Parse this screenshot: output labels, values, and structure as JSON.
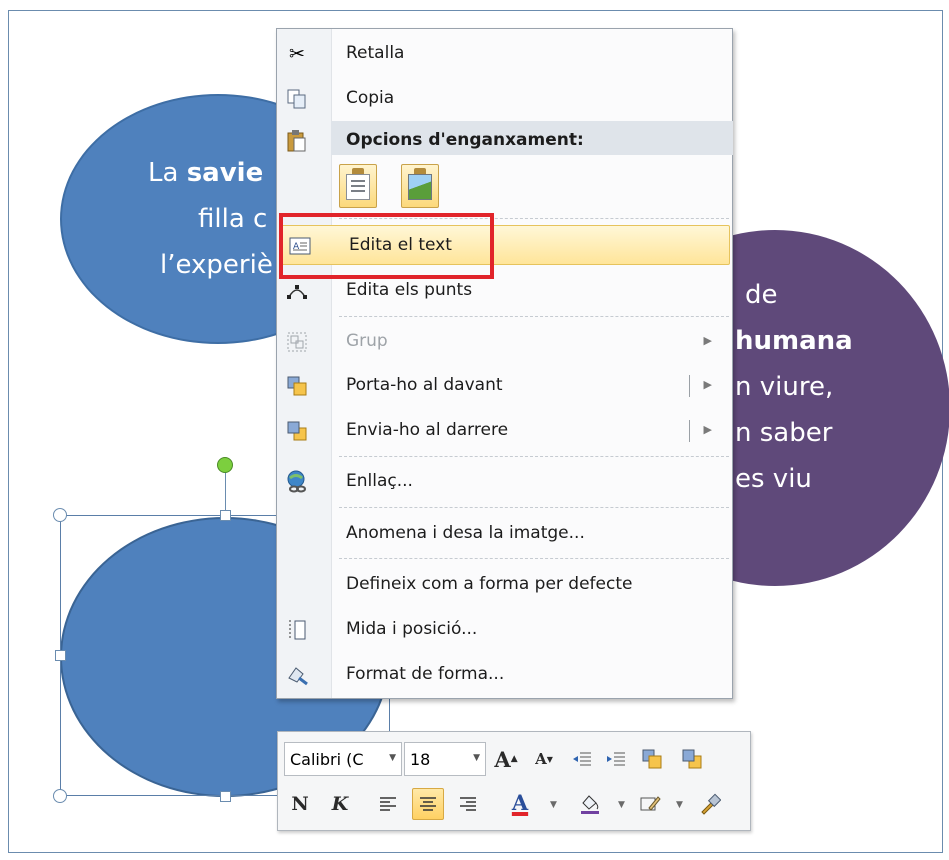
{
  "slide": {
    "top_left_text": {
      "line1_pre": "La ",
      "line1_bold": "savie",
      "line2": "filla c",
      "line3": "l’experiè"
    },
    "right_text": {
      "line1": "de",
      "line2_bold": "humana",
      "line3": "n viure,",
      "line4": "n saber",
      "line5": "es viu"
    }
  },
  "context_menu": {
    "items": [
      {
        "label": "Retalla",
        "icon": "scissors-icon"
      },
      {
        "label": "Copia",
        "icon": "copy-icon"
      },
      {
        "label": "Opcions d'enganxament:",
        "icon": "paste-icon"
      },
      {
        "label": "Edita el text",
        "icon": "edit-text-icon"
      },
      {
        "label": "Edita els punts",
        "icon": "edit-points-icon"
      },
      {
        "label": "Grup",
        "icon": "group-icon"
      },
      {
        "label": "Porta-ho al davant",
        "icon": "bring-forward-icon"
      },
      {
        "label": "Envia-ho al darrere",
        "icon": "send-backward-icon"
      },
      {
        "label": "Enllaç...",
        "icon": "hyperlink-icon"
      },
      {
        "label": "Anomena i desa la imatge...",
        "icon": ""
      },
      {
        "label": "Defineix com a forma per defecte",
        "icon": ""
      },
      {
        "label": "Mida i posició...",
        "icon": "size-position-icon"
      },
      {
        "label": "Format de forma...",
        "icon": "format-shape-icon"
      }
    ],
    "paste_options": [
      "keep-text-only-icon",
      "picture-icon"
    ],
    "highlighted_item": "Edita el text",
    "disabled_items": [
      "Grup"
    ]
  },
  "mini_toolbar": {
    "font_name": "Calibri (C",
    "font_size": "18",
    "row1": [
      "grow-font-icon",
      "shrink-font-icon",
      "decrease-indent-icon",
      "increase-indent-icon",
      "bring-forward-icon",
      "send-backward-icon"
    ],
    "row2": {
      "bold": "N",
      "italic": "K",
      "font_color_letter": "A"
    }
  },
  "colors": {
    "shape_blue": "#4f81bd",
    "shape_purple": "#5f497a",
    "highlight_red": "#e1242a",
    "menu_hover": "#ffe59a"
  }
}
